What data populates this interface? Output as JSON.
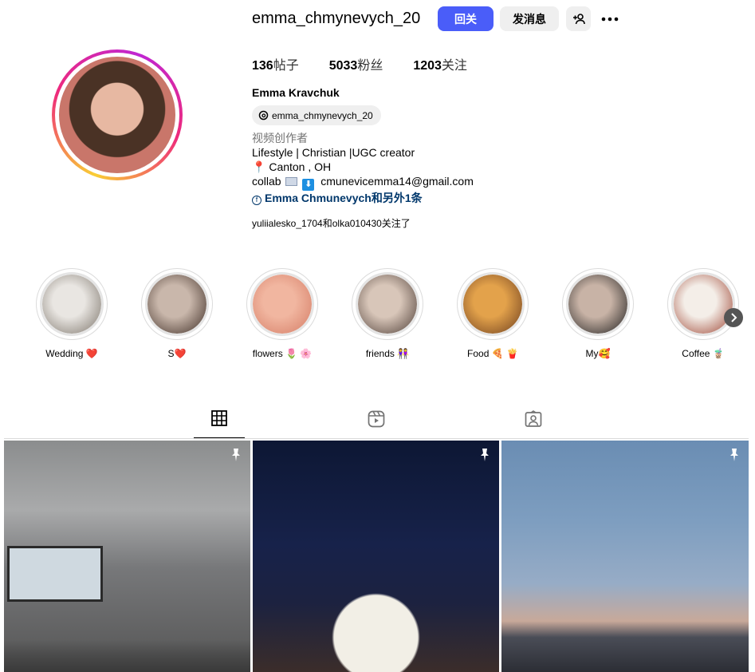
{
  "header": {
    "username": "emma_chmynevych_20",
    "follow_label": "回关",
    "message_label": "发消息",
    "adduser_icon": "+⁠👤",
    "more_label": "•••"
  },
  "stats": {
    "posts_value": "136",
    "posts_label": "帖子",
    "followers_value": "5033",
    "followers_label": "粉丝",
    "following_value": "1203",
    "following_label": "关注"
  },
  "profile": {
    "full_name": "Emma Kravchuk",
    "threads_handle": "emma_chmynevych_20",
    "category": "视频创作者",
    "bio_line1": "Lifestyle | Christian |UGC creator",
    "bio_location": "Canton , OH",
    "bio_collab_prefix": "collab",
    "bio_email": "cmunevicemma14@gmail.com",
    "bio_link": "Emma Chmunevych和另外1条",
    "followed_by": "yuliialesko_1704和olka010430关注了"
  },
  "highlights": [
    {
      "label": "Wedding ❤️",
      "c1": "#e9e6e2",
      "c2": "#7a7268"
    },
    {
      "label": "S❤️",
      "c1": "#c9b7ab",
      "c2": "#3b2a22"
    },
    {
      "label": "flowers 🌷 🌸",
      "c1": "#f1b6a0",
      "c2": "#d47b64"
    },
    {
      "label": "friends 👭",
      "c1": "#d8c6b9",
      "c2": "#4a3a33"
    },
    {
      "label": "Food 🍕 🍟",
      "c1": "#e3a24b",
      "c2": "#6b3c1d"
    },
    {
      "label": "My🥰",
      "c1": "#c8b3a6",
      "c2": "#1a1a1a"
    },
    {
      "label": "Coffee 🧋",
      "c1": "#f4eee8",
      "c2": "#9a3e2c"
    }
  ],
  "tabs": [
    "grid",
    "reels",
    "tagged"
  ],
  "colors": {
    "accent": "#4a5df9",
    "link": "#00376b"
  }
}
